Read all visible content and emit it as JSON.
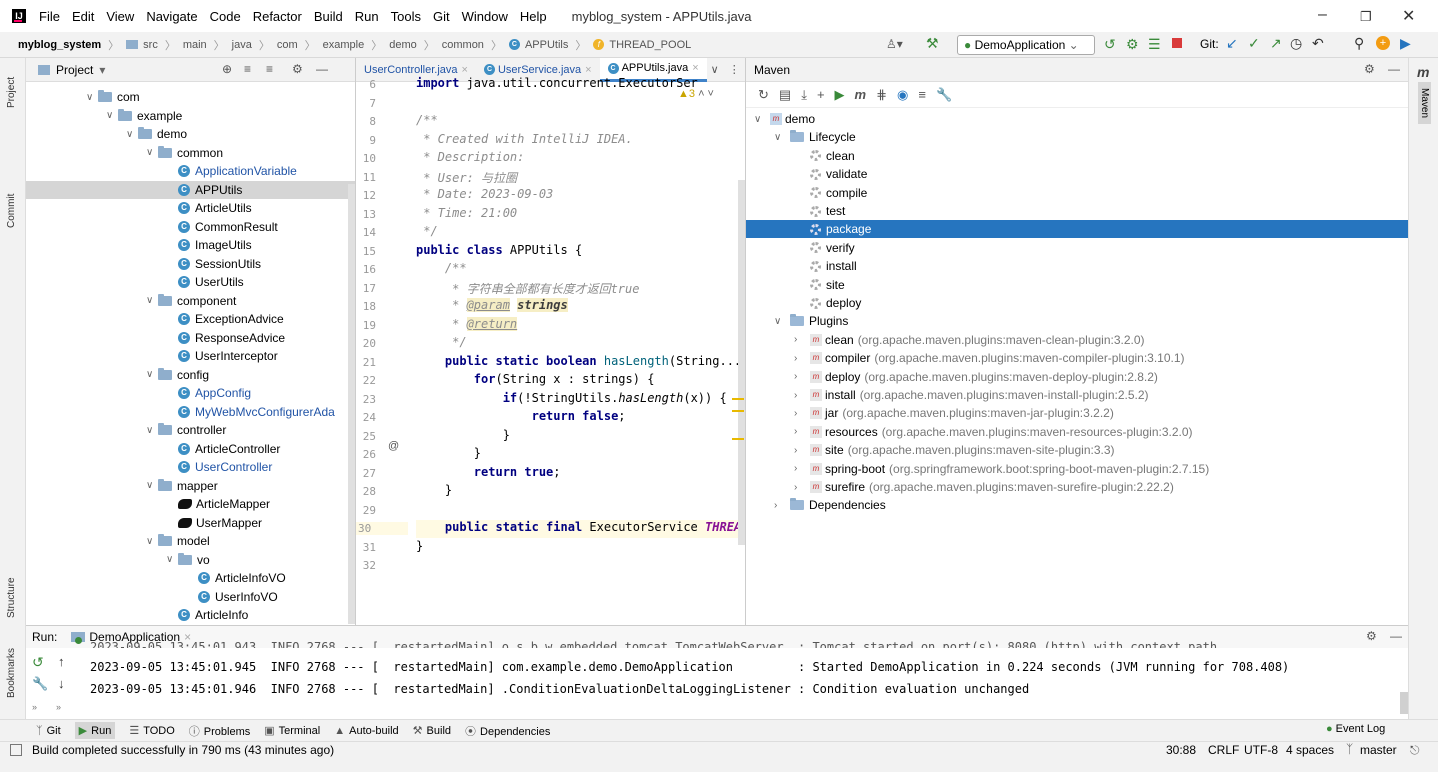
{
  "app": {
    "menu": [
      "File",
      "Edit",
      "View",
      "Navigate",
      "Code",
      "Refactor",
      "Build",
      "Run",
      "Tools",
      "Git",
      "Window",
      "Help"
    ],
    "window_title": "myblog_system - APPUtils.java"
  },
  "navbar": {
    "crumbs": [
      "myblog_system",
      "src",
      "main",
      "java",
      "com",
      "example",
      "demo",
      "common",
      "APPUtils",
      "THREAD_POOL"
    ],
    "run_config": "DemoApplication",
    "git_label": "Git:"
  },
  "left_strip": {
    "project": "Project",
    "commit": "Commit",
    "structure": "Structure",
    "bookmarks": "Bookmarks"
  },
  "right_strip": {
    "maven": "Maven"
  },
  "project": {
    "header": "Project",
    "tree": [
      {
        "label": "com",
        "type": "folder",
        "depth": 0,
        "open": true
      },
      {
        "label": "example",
        "type": "folder",
        "depth": 1,
        "open": true
      },
      {
        "label": "demo",
        "type": "folder",
        "depth": 2,
        "open": true
      },
      {
        "label": "common",
        "type": "folder",
        "depth": 3,
        "open": true
      },
      {
        "label": "ApplicationVariable",
        "type": "class",
        "depth": 4,
        "color": "blue"
      },
      {
        "label": "APPUtils",
        "type": "class",
        "depth": 4,
        "selected": true
      },
      {
        "label": "ArticleUtils",
        "type": "class",
        "depth": 4
      },
      {
        "label": "CommonResult",
        "type": "class",
        "depth": 4
      },
      {
        "label": "ImageUtils",
        "type": "class",
        "depth": 4
      },
      {
        "label": "SessionUtils",
        "type": "class",
        "depth": 4
      },
      {
        "label": "UserUtils",
        "type": "class",
        "depth": 4
      },
      {
        "label": "component",
        "type": "folder",
        "depth": 3,
        "open": true
      },
      {
        "label": "ExceptionAdvice",
        "type": "class",
        "depth": 4
      },
      {
        "label": "ResponseAdvice",
        "type": "class",
        "depth": 4
      },
      {
        "label": "UserInterceptor",
        "type": "class",
        "depth": 4
      },
      {
        "label": "config",
        "type": "folder",
        "depth": 3,
        "open": true
      },
      {
        "label": "AppConfig",
        "type": "class",
        "depth": 4,
        "color": "blue"
      },
      {
        "label": "MyWebMvcConfigurerAda",
        "type": "class",
        "depth": 4,
        "color": "blue"
      },
      {
        "label": "controller",
        "type": "folder",
        "depth": 3,
        "open": true
      },
      {
        "label": "ArticleController",
        "type": "class",
        "depth": 4
      },
      {
        "label": "UserController",
        "type": "class",
        "depth": 4,
        "color": "blue"
      },
      {
        "label": "mapper",
        "type": "folder",
        "depth": 3,
        "open": true
      },
      {
        "label": "ArticleMapper",
        "type": "mapper",
        "depth": 4
      },
      {
        "label": "UserMapper",
        "type": "mapper",
        "depth": 4
      },
      {
        "label": "model",
        "type": "folder",
        "depth": 3,
        "open": true
      },
      {
        "label": "vo",
        "type": "folder",
        "depth": 4,
        "open": true
      },
      {
        "label": "ArticleInfoVO",
        "type": "class",
        "depth": 5
      },
      {
        "label": "UserInfoVO",
        "type": "class",
        "depth": 5
      },
      {
        "label": "ArticleInfo",
        "type": "class",
        "depth": 4
      }
    ]
  },
  "editor": {
    "tabs": [
      "UserController.java",
      "UserService.java",
      "APPUtils.java"
    ],
    "active_tab": 2,
    "warnings": "3",
    "lines": [
      {
        "n": "6",
        "html": "<span class='kw'>import</span> java.util.concurrent.ExecutorSer"
      },
      {
        "n": "7",
        "html": ""
      },
      {
        "n": "8",
        "html": "<span class='cm'>/**</span>"
      },
      {
        "n": "9",
        "html": "<span class='cm'> * Created with IntelliJ IDEA.</span>"
      },
      {
        "n": "10",
        "html": "<span class='cm'> * Description:</span>"
      },
      {
        "n": "11",
        "html": "<span class='cm'> * User: 与拉圈</span>"
      },
      {
        "n": "12",
        "html": "<span class='cm'> * Date: 2023-09-03</span>"
      },
      {
        "n": "13",
        "html": "<span class='cm'> * Time: 21:00</span>"
      },
      {
        "n": "14",
        "html": "<span class='cm'> */</span>"
      },
      {
        "n": "15",
        "html": "<span class='kw'>public class</span> APPUtils {"
      },
      {
        "n": "16",
        "html": "    <span class='cm'>/**</span>"
      },
      {
        "n": "17",
        "html": "<span class='cm'>     * 字符串全部都有长度才返回true</span>"
      },
      {
        "n": "18",
        "html": "<span class='cm'>     * </span><span class='tag'>@param</span> <span class='param'>strings</span>"
      },
      {
        "n": "19",
        "html": "<span class='cm'>     * </span><span class='tag'>@return</span>"
      },
      {
        "n": "20",
        "html": "<span class='cm'>     */</span>"
      },
      {
        "n": "21",
        "html": "    <span class='kw'>public static boolean</span> <span class='fn'>hasLength</span>(String..."
      },
      {
        "n": "22",
        "html": "        <span class='kw'>for</span>(String x : strings) {"
      },
      {
        "n": "23",
        "html": "            <span class='kw'>if</span>(!StringUtils.<span class='ital'>hasLength</span>(x)) {"
      },
      {
        "n": "24",
        "html": "                <span class='kw'>return false</span>;"
      },
      {
        "n": "25",
        "html": "            }"
      },
      {
        "n": "26",
        "html": "        }"
      },
      {
        "n": "27",
        "html": "        <span class='kw'>return true</span>;"
      },
      {
        "n": "28",
        "html": "    }"
      },
      {
        "n": "29",
        "html": ""
      },
      {
        "n": "30",
        "html": "    <span class='kw'>public static final</span> ExecutorService <span style='color:#871094;font-weight:bold;font-style:italic'>THREA</span>"
      },
      {
        "n": "31",
        "html": "}"
      },
      {
        "n": "32",
        "html": ""
      }
    ]
  },
  "maven": {
    "header": "Maven",
    "rows": [
      {
        "depth": 0,
        "type": "module",
        "label": "demo",
        "open": true
      },
      {
        "depth": 1,
        "type": "folder",
        "label": "Lifecycle",
        "open": true
      },
      {
        "depth": 2,
        "type": "goal",
        "label": "clean"
      },
      {
        "depth": 2,
        "type": "goal",
        "label": "validate"
      },
      {
        "depth": 2,
        "type": "goal",
        "label": "compile"
      },
      {
        "depth": 2,
        "type": "goal",
        "label": "test"
      },
      {
        "depth": 2,
        "type": "goal",
        "label": "package",
        "selected": true
      },
      {
        "depth": 2,
        "type": "goal",
        "label": "verify"
      },
      {
        "depth": 2,
        "type": "goal",
        "label": "install"
      },
      {
        "depth": 2,
        "type": "goal",
        "label": "site"
      },
      {
        "depth": 2,
        "type": "goal",
        "label": "deploy"
      },
      {
        "depth": 1,
        "type": "folder",
        "label": "Plugins",
        "open": true
      },
      {
        "depth": 2,
        "type": "plugin",
        "label": "clean",
        "detail": "(org.apache.maven.plugins:maven-clean-plugin:3.2.0)"
      },
      {
        "depth": 2,
        "type": "plugin",
        "label": "compiler",
        "detail": "(org.apache.maven.plugins:maven-compiler-plugin:3.10.1)"
      },
      {
        "depth": 2,
        "type": "plugin",
        "label": "deploy",
        "detail": "(org.apache.maven.plugins:maven-deploy-plugin:2.8.2)"
      },
      {
        "depth": 2,
        "type": "plugin",
        "label": "install",
        "detail": "(org.apache.maven.plugins:maven-install-plugin:2.5.2)"
      },
      {
        "depth": 2,
        "type": "plugin",
        "label": "jar",
        "detail": "(org.apache.maven.plugins:maven-jar-plugin:3.2.2)"
      },
      {
        "depth": 2,
        "type": "plugin",
        "label": "resources",
        "detail": "(org.apache.maven.plugins:maven-resources-plugin:3.2.0)"
      },
      {
        "depth": 2,
        "type": "plugin",
        "label": "site",
        "detail": "(org.apache.maven.plugins:maven-site-plugin:3.3)"
      },
      {
        "depth": 2,
        "type": "plugin",
        "label": "spring-boot",
        "detail": "(org.springframework.boot:spring-boot-maven-plugin:2.7.15)"
      },
      {
        "depth": 2,
        "type": "plugin",
        "label": "surefire",
        "detail": "(org.apache.maven.plugins:maven-surefire-plugin:2.22.2)"
      },
      {
        "depth": 1,
        "type": "deps",
        "label": "Dependencies",
        "open": false
      }
    ]
  },
  "run": {
    "label": "Run:",
    "tab": "DemoApplication",
    "log": [
      "2023-09-05 13:45:01.945  INFO 2768 --- [  restartedMain] com.example.demo.DemoApplication         : Started DemoApplication in 0.224 seconds (JVM running for 708.408)",
      "2023-09-05 13:45:01.946  INFO 2768 --- [  restartedMain] .ConditionEvaluationDeltaLoggingListener : Condition evaluation unchanged"
    ],
    "truncated_line": "2023-09-05 13:45:01.943  INFO 2768 --- [  restartedMain] o.s.b.w.embedded.tomcat.TomcatWebServer  : Tomcat started on port(s): 8080 (http) with context path"
  },
  "toolwindows": [
    "Git",
    "Run",
    "TODO",
    "Problems",
    "Terminal",
    "Auto-build",
    "Build",
    "Dependencies"
  ],
  "event_log": "Event Log",
  "status": {
    "message": "Build completed successfully in 790 ms (43 minutes ago)",
    "position": "30:88",
    "line_sep": "CRLF",
    "encoding": "UTF-8",
    "indent": "4 spaces",
    "branch": "master"
  }
}
